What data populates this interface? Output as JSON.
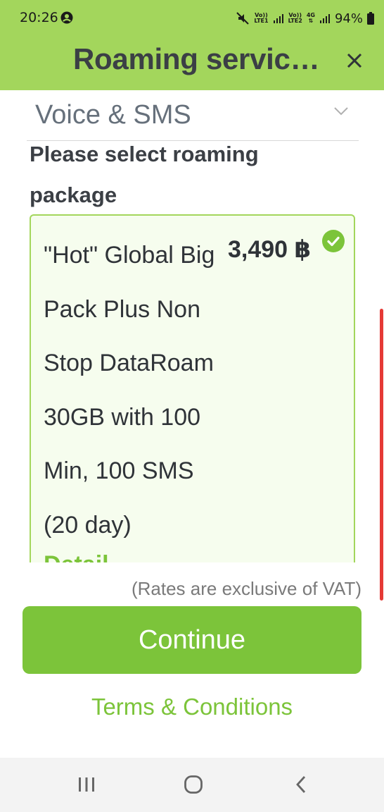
{
  "status_bar": {
    "time": "20:26",
    "sim1": {
      "top": "Vo))",
      "bottom": "LTE1"
    },
    "sim2": {
      "top": "Vo))",
      "bottom": "LTE2"
    },
    "network": "4G",
    "battery": "94%"
  },
  "header": {
    "title": "Roaming servic…",
    "background": "#a3d65c"
  },
  "category": {
    "label": "Voice & SMS"
  },
  "section": {
    "title": "Please select roaming package"
  },
  "package": {
    "name": "\"Hot\" Global Big Pack Plus Non Stop DataRoam 30GB with 100 Min, 100 SMS (20 day)",
    "price": "3,490 ฿",
    "details_label": "Detail",
    "selected": true
  },
  "footer": {
    "vat_note": "(Rates are exclusive of VAT)",
    "continue_label": "Continue",
    "terms_label": "Terms & Conditions",
    "accent_color": "#7cc43a"
  }
}
